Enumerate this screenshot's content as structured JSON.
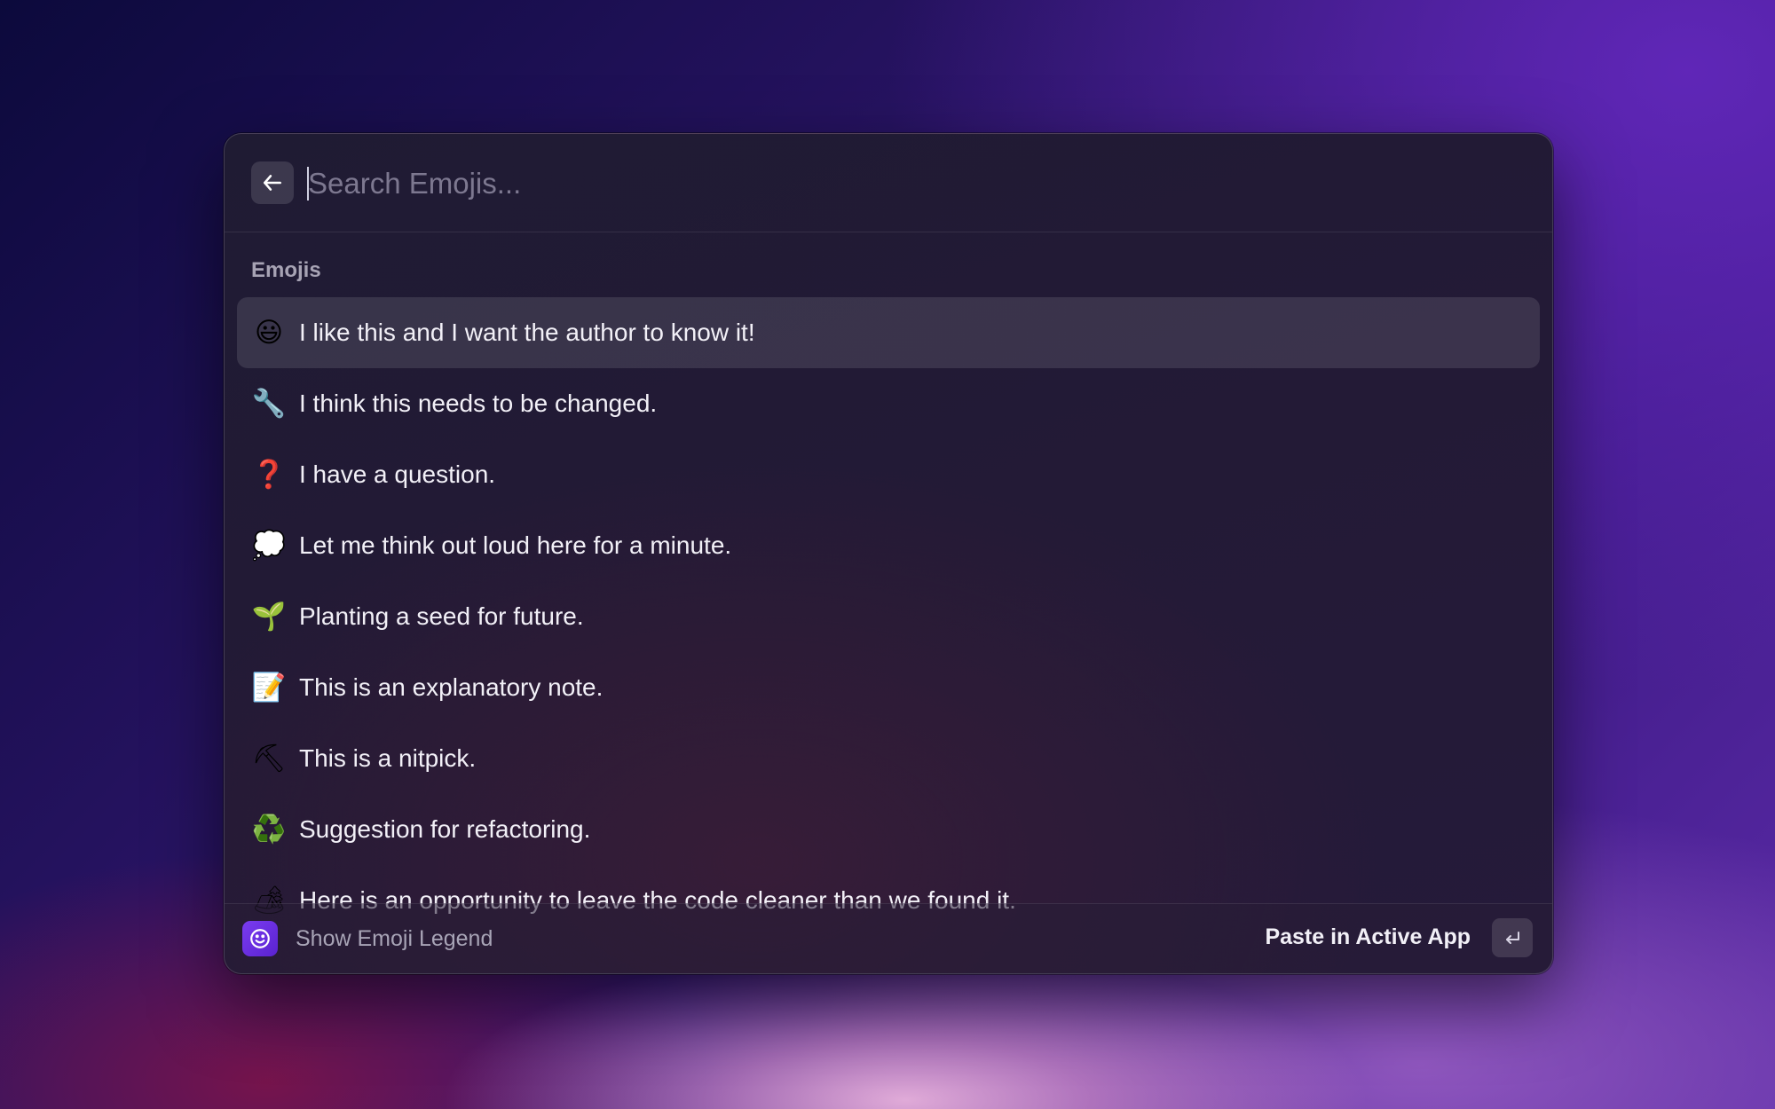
{
  "search": {
    "placeholder": "Search Emojis...",
    "value": ""
  },
  "section": {
    "title": "Emojis"
  },
  "items": [
    {
      "emoji": "😃",
      "label": "I like this and I want the author to know it!",
      "selected": true
    },
    {
      "emoji": "🔧",
      "label": "I think this needs to be changed.",
      "selected": false
    },
    {
      "emoji": "❓",
      "label": "I have a question.",
      "selected": false
    },
    {
      "emoji": "💭",
      "label": "Let me think out loud here for a minute.",
      "selected": false
    },
    {
      "emoji": "🌱",
      "label": "Planting a seed for future.",
      "selected": false
    },
    {
      "emoji": "📝",
      "label": "This is an explanatory note.",
      "selected": false
    },
    {
      "emoji": "⛏",
      "label": "This is a nitpick.",
      "selected": false
    },
    {
      "emoji": "♻️",
      "label": "Suggestion for refactoring.",
      "selected": false
    },
    {
      "emoji": "🏕",
      "label": "Here is an opportunity to leave the code cleaner than we found it.",
      "selected": false
    }
  ],
  "footer": {
    "legend_label": "Show Emoji Legend",
    "action_label": "Paste in Active App"
  },
  "icons": {
    "back": "arrow-left-icon",
    "legend": "smiley-icon",
    "enter": "return-key-icon"
  },
  "colors": {
    "accent": "#6a2fe0",
    "selected_row": "#3a3148"
  }
}
